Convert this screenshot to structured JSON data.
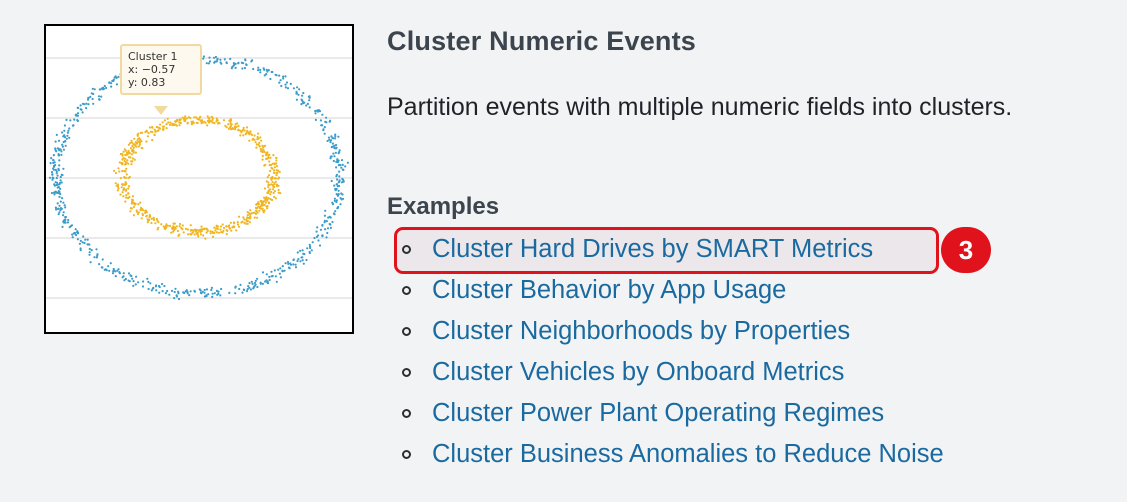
{
  "thumbnail": {
    "tooltip": {
      "line1": "Cluster 1",
      "line2": "x: −0.57",
      "line3": "y: 0.83"
    },
    "colors": {
      "outer": "#3b9bc9",
      "inner": "#f0b521",
      "grid": "#d6d6d6"
    }
  },
  "title": "Cluster Numeric Events",
  "description": "Partition events with multiple numeric fields into clusters.",
  "examples_heading": "Examples",
  "examples": [
    "Cluster Hard Drives by SMART Metrics",
    "Cluster Behavior by App Usage",
    "Cluster Neighborhoods by Properties",
    "Cluster Vehicles by Onboard Metrics",
    "Cluster Power Plant Operating Regimes",
    "Cluster Business Anomalies to Reduce Noise"
  ],
  "annotation": {
    "badge": "3",
    "color": "#e0121b"
  }
}
